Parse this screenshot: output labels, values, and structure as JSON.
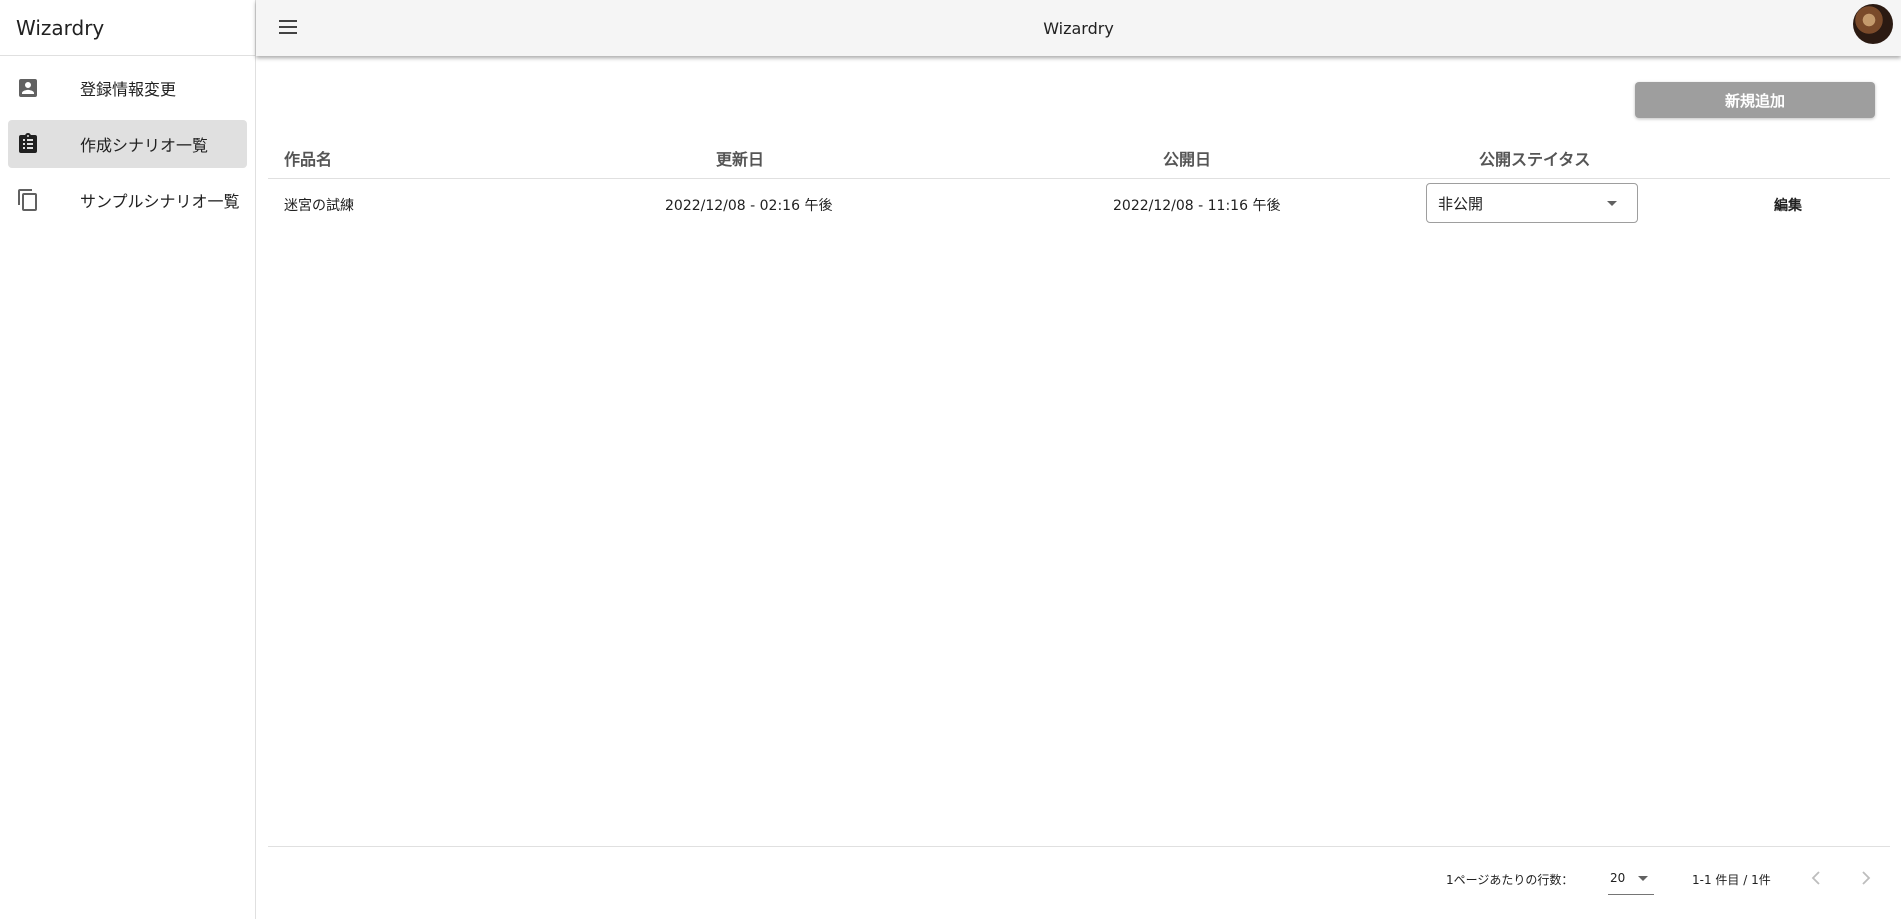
{
  "app": {
    "name": "Wizardry",
    "title": "Wizardry"
  },
  "sidebar": {
    "items": [
      {
        "label": "登録情報変更",
        "icon": "account-box-icon",
        "active": false
      },
      {
        "label": "作成シナリオ一覧",
        "icon": "clipboard-list-icon",
        "active": true
      },
      {
        "label": "サンプルシナリオ一覧",
        "icon": "copy-icon",
        "active": false
      }
    ]
  },
  "toolbar": {
    "add_label": "新規追加"
  },
  "table": {
    "columns": [
      "作品名",
      "更新日",
      "公開日",
      "公開ステイタス"
    ],
    "rows": [
      {
        "title": "迷宮の試練",
        "updated": "2022/12/08 - 02:16 午後",
        "published": "2022/12/08 - 11:16 午後",
        "status": "非公開",
        "action": "編集"
      }
    ]
  },
  "pagination": {
    "rows_per_page_label": "1ページあたりの行数：",
    "rows_per_page": "20",
    "range": "1-1 件目 / 1件"
  },
  "colors": {
    "add_button_bg": "#9e9e9e",
    "appbar_bg": "#f5f5f5",
    "active_nav_bg": "#e0e0e0"
  }
}
